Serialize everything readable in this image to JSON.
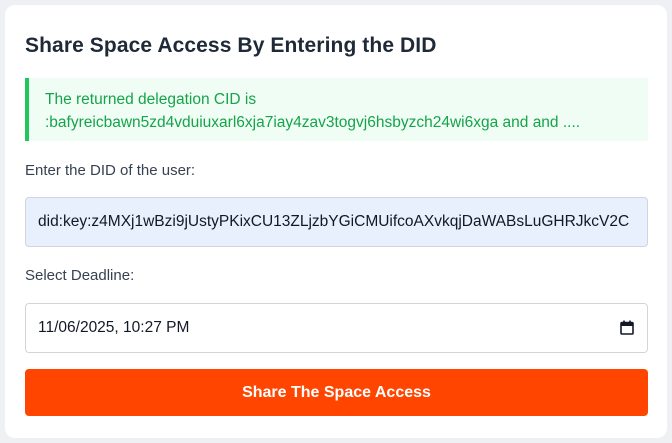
{
  "form": {
    "title": "Share Space Access By Entering the DID",
    "alert": {
      "line1": "The returned delegation CID is",
      "line2": ":bafyreicbawn5zd4vduiuxarl6xja7iay4zav3togvj6hsbyzch24wi6xga and and ...."
    },
    "did_label": "Enter the DID of the user:",
    "did_value": "did:key:z4MXj1wBzi9jUstyPKixCU13ZLjzbYGiCMUifcoAXvkqjDaWABsLuGHRJkcV2C",
    "deadline_label": "Select Deadline:",
    "deadline_value": "11/06/2025, 10:27 PM",
    "calendar_icon": "calendar-icon",
    "submit_label": "Share The Space Access",
    "colors": {
      "accent": "#ff4500",
      "alert_text": "#16a34a",
      "alert_border": "#22c55e",
      "alert_bg": "#f0fdf4",
      "autofill_bg": "#e8f0fe"
    }
  }
}
